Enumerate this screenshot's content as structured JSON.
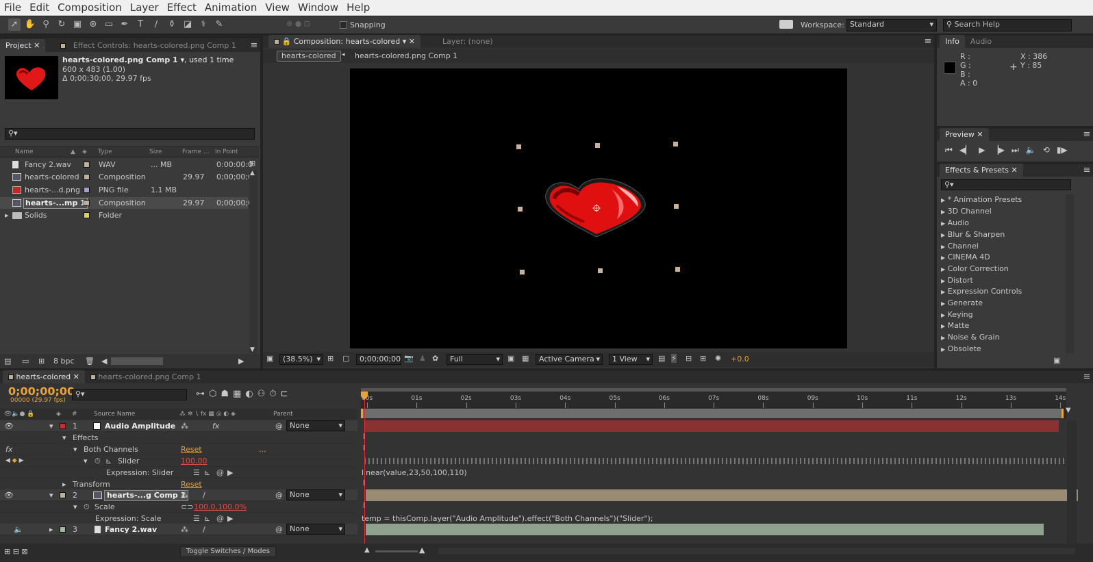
{
  "menu": [
    "File",
    "Edit",
    "Composition",
    "Layer",
    "Effect",
    "Animation",
    "View",
    "Window",
    "Help"
  ],
  "toolbar": {
    "snapping": "Snapping",
    "workspace_label": "Workspace:",
    "workspace_value": "Standard",
    "search_placeholder": "Search Help"
  },
  "project": {
    "tab": "Project",
    "tab2": "Effect Controls: hearts-colored.png Comp 1",
    "comp_name": "hearts-colored.png Comp 1",
    "comp_used": ", used 1 time",
    "dims": "600 x 483 (1.00)",
    "duration": "Δ 0;00;30;00, 29.97 fps",
    "columns": [
      "Name",
      "Type",
      "Size",
      "Frame ...",
      "In Point"
    ],
    "items": [
      {
        "name": "Fancy 2.wav",
        "type": "WAV",
        "size": "... MB",
        "fps": "",
        "in": "0:00:00:0",
        "color": "#bfb09a"
      },
      {
        "name": "hearts-colored",
        "type": "Composition",
        "size": "",
        "fps": "29.97",
        "in": "0;00;00;0",
        "color": "#bfb09a"
      },
      {
        "name": "hearts-...d.png",
        "type": "PNG file",
        "size": "1.1 MB",
        "fps": "",
        "in": "",
        "color": "#a89cd0"
      },
      {
        "name": "hearts-...mp 1",
        "type": "Composition",
        "size": "",
        "fps": "29.97",
        "in": "0;00;00;0",
        "color": "#bfb09a"
      },
      {
        "name": "Solids",
        "type": "Folder",
        "size": "",
        "fps": "",
        "in": "",
        "color": "#e0d050"
      }
    ],
    "bpc": "8 bpc"
  },
  "comp": {
    "tab": "Composition: hearts-colored",
    "layer_tab": "Layer: (none)",
    "crumb1": "hearts-colored",
    "crumb2": "hearts-colored.png Comp 1",
    "zoom": "(38.5%)",
    "timecode": "0;00;00;00",
    "resolution": "Full",
    "camera": "Active Camera",
    "view": "1 View",
    "exposure": "+0.0"
  },
  "info": {
    "tab": "Info",
    "tab2": "Audio",
    "r": "R :",
    "g": "G :",
    "b": "B :",
    "a": "A : 0",
    "x": "X : 386",
    "y": "Y : 85"
  },
  "preview": {
    "tab": "Preview"
  },
  "effects": {
    "tab": "Effects & Presets",
    "items": [
      "* Animation Presets",
      "3D Channel",
      "Audio",
      "Blur & Sharpen",
      "Channel",
      "CINEMA 4D",
      "Color Correction",
      "Distort",
      "Expression Controls",
      "Generate",
      "Keying",
      "Matte",
      "Noise & Grain",
      "Obsolete"
    ]
  },
  "timeline": {
    "tab1": "hearts-colored",
    "tab2": "hearts-colored.png Comp 1",
    "timecode": "0;00;00;00",
    "fps_info": "00000 (29.97 fps)",
    "col_source": "Source Name",
    "col_parent": "Parent",
    "ruler": [
      "00s",
      "01s",
      "02s",
      "03s",
      "04s",
      "05s",
      "06s",
      "07s",
      "08s",
      "09s",
      "10s",
      "11s",
      "12s",
      "13s",
      "14s"
    ],
    "layer1": {
      "num": "1",
      "name": "Audio Amplitude",
      "parent": "None"
    },
    "effects_label": "Effects",
    "both_channels": "Both Channels",
    "reset": "Reset",
    "dots": "...",
    "slider": "Slider",
    "slider_value": "100.00",
    "expr_slider": "Expression: Slider",
    "expr_slider_text": "linear(value,23,50,100,110)",
    "transform": "Transform",
    "layer2": {
      "num": "2",
      "name": "hearts-...g Comp 1",
      "parent": "None"
    },
    "scale": "Scale",
    "scale_value": "100.0,100.0%",
    "expr_scale": "Expression: Scale",
    "expr_scale_text": "temp = thisComp.layer(\"Audio Amplitude\").effect(\"Both Channels\")(\"Slider\");",
    "layer3": {
      "num": "3",
      "name": "Fancy 2.wav",
      "parent": "None"
    },
    "toggle": "Toggle Switches / Modes",
    "fx": "fx"
  }
}
